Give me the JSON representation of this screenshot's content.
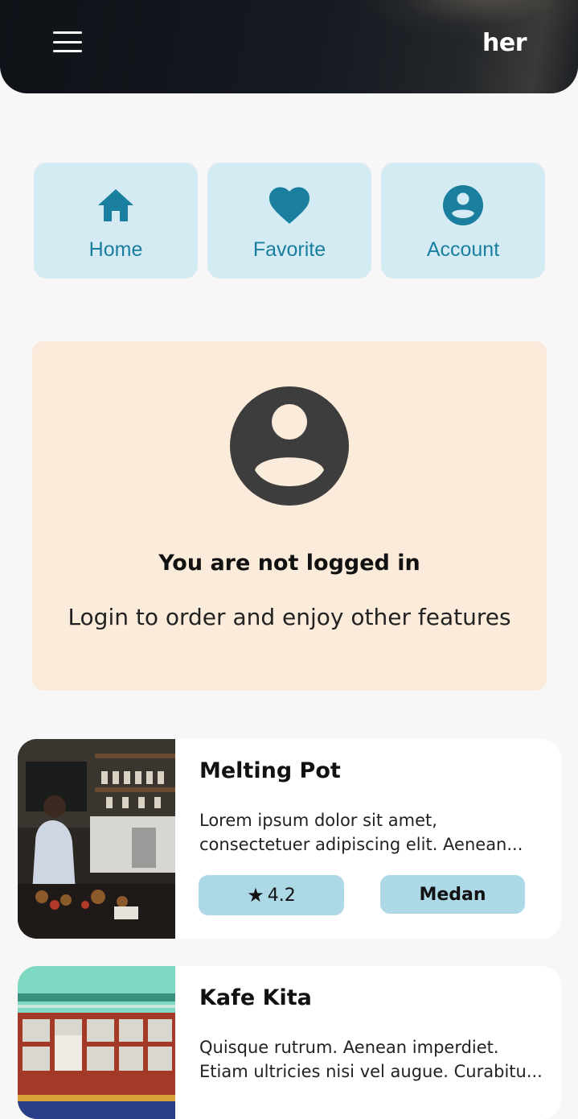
{
  "header": {
    "brand": "her",
    "menu_icon": "hamburger-menu-icon"
  },
  "nav": {
    "items": [
      {
        "label": "Home",
        "icon": "home-icon"
      },
      {
        "label": "Favorite",
        "icon": "heart-icon"
      },
      {
        "label": "Account",
        "icon": "account-circle-icon"
      }
    ],
    "tile_color": "#d4ebf3",
    "accent_color": "#1a7f9e"
  },
  "login_prompt": {
    "icon": "account-circle-icon",
    "title": "You are not logged in",
    "subtitle": "Login to order and enjoy other features",
    "background": "#faebdb"
  },
  "places": [
    {
      "name": "Melting Pot",
      "description_line1": "Lorem ipsum dolor sit amet,",
      "description_line2": "consectetuer adipiscing elit. Aenean...",
      "rating": "4.2",
      "city": "Medan"
    },
    {
      "name": "Kafe Kita",
      "description_line1": "Quisque rutrum. Aenean imperdiet.",
      "description_line2": "Etiam ultricies nisi vel augue. Curabitu..."
    }
  ],
  "chip_color": "#add8e6"
}
